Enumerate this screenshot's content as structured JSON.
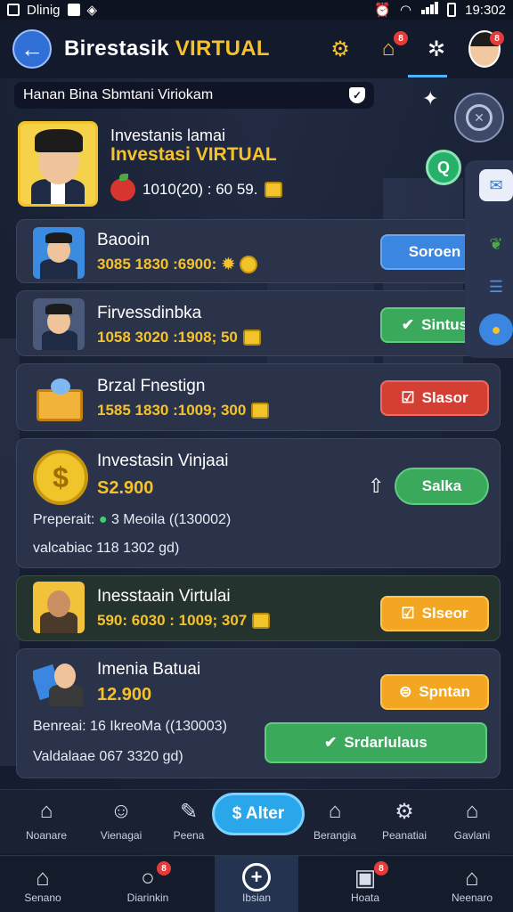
{
  "status_bar": {
    "time": "19:302",
    "carrier": "Dlinig"
  },
  "header": {
    "back_icon": "arrow-left-icon",
    "title_main": "Birestasik",
    "title_accent": "VIRTUAL",
    "home_badge": "8",
    "avatar_badge": "8"
  },
  "banner": {
    "text": "Hanan Bina Sbmtani Viriokam"
  },
  "profile": {
    "subtitle": "Investanis lamai",
    "title": "Investasi VIRTUAL",
    "stats": "1010(20) : 60 59."
  },
  "cards": [
    {
      "name": "Baooin",
      "stats": "3085 1830 :6900:",
      "button": "Soroen",
      "button_color": "#3b86e0"
    },
    {
      "name": "Firvessdinbka",
      "stats": "1058 3020 :1908; 50",
      "button": "Sintus",
      "button_color": "#3aa95c"
    },
    {
      "name": "Brzal Fnestign",
      "stats": "1585 1830 :1009; 300",
      "button": "Slasor",
      "button_color": "#d43f34"
    },
    {
      "name": "Investasin Vinjaai",
      "amount": "S2.900",
      "button": "Salka",
      "label1_key": "Preperait:",
      "label1_val": "3 Meoila ((130002)",
      "label2": "valcabiac 118 1302 gd)"
    },
    {
      "name": "Inesstaain Virtulai",
      "stats": "590: 6030 : 1009; 307",
      "button": "Slseor",
      "button_color": "#f2a622"
    },
    {
      "name": "Imenia Batuai",
      "amount": "12.900",
      "button": "Spntan",
      "button_wide": "Srdarlulaus",
      "label1_key": "Benreai:",
      "label1_val": "16 IkreoMa ((130003)",
      "label2": "Valdalaae 067 3320 gd)"
    }
  ],
  "quickbar": {
    "items": [
      "Noanare",
      "Vienagai",
      "Peena",
      "Berangia",
      "Peanatiai",
      "Gavlani"
    ],
    "alert_button": "$ Alter"
  },
  "bottomnav": {
    "items": [
      "Senano",
      "Diarinkin",
      "Ibsian",
      "Hoata",
      "Neenaro"
    ],
    "badge_search": "8",
    "badge_box": "8"
  }
}
